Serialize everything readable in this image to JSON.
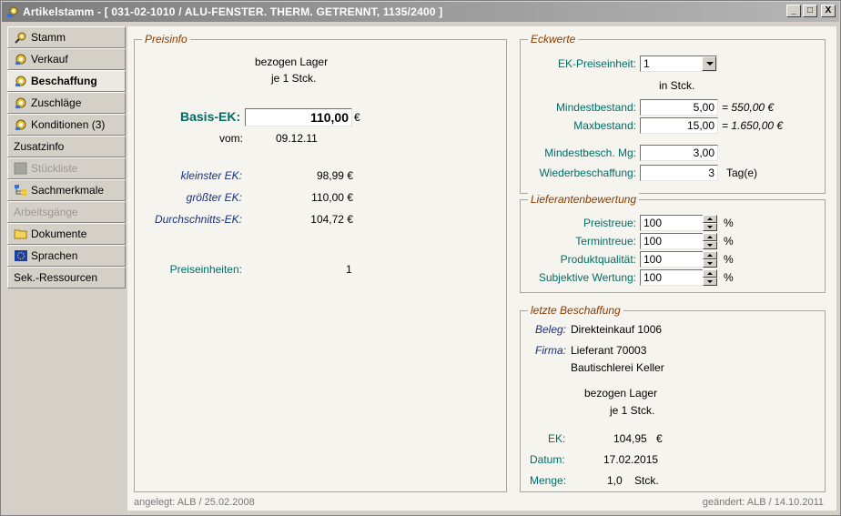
{
  "window": {
    "title": "Artikelstamm - [ 031-02-1010 / ALU-FENSTER. THERM. GETRENNT, 1135/2400 ]",
    "btn_minimize": "_",
    "btn_maximize": "□",
    "btn_close": "X"
  },
  "sidebar": {
    "items": [
      {
        "label": "Stamm"
      },
      {
        "label": "Verkauf"
      },
      {
        "label": "Beschaffung"
      },
      {
        "label": "Zuschläge"
      },
      {
        "label": "Konditionen (3)"
      },
      {
        "label": "Zusatzinfo"
      },
      {
        "label": "Stückliste"
      },
      {
        "label": "Sachmerkmale"
      },
      {
        "label": "Arbeitsgänge"
      },
      {
        "label": "Dokumente"
      },
      {
        "label": "Sprachen"
      },
      {
        "label": "Sek.-Ressourcen"
      }
    ]
  },
  "preisinfo": {
    "legend": "Preisinfo",
    "header_line1": "bezogen Lager",
    "header_line2": "je 1 Stck.",
    "basis_ek_label": "Basis-EK:",
    "basis_ek_value": "110,00",
    "currency": "€",
    "vom_label": "vom:",
    "vom_value": "09.12.11",
    "kleinster_label": "kleinster EK:",
    "kleinster_value": "98,99 €",
    "groesster_label": "größter EK:",
    "groesster_value": "110,00 €",
    "durchschnitt_label": "Durchschnitts-EK:",
    "durchschnitt_value": "104,72 €",
    "preiseinheiten_label": "Preiseinheiten:",
    "preiseinheiten_value": "1"
  },
  "eckwerte": {
    "legend": "Eckwerte",
    "ek_preiseinheit_label": "EK-Preiseinheit:",
    "ek_preiseinheit_value": "1",
    "unit_text": "in Stck.",
    "mindestbestand_label": "Mindestbestand:",
    "mindestbestand_value": "5,00",
    "mindestbestand_calc": "= 550,00 €",
    "maxbestand_label": "Maxbestand:",
    "maxbestand_value": "15,00",
    "maxbestand_calc": "= 1.650,00 €",
    "mindestbesch_label": "Mindestbesch. Mg:",
    "mindestbesch_value": "3,00",
    "wiederbeschaffung_label": "Wiederbeschaffung:",
    "wiederbeschaffung_value": "3",
    "wiederbeschaffung_unit": "Tag(e)"
  },
  "lieferanten": {
    "legend": "Lieferantenbewertung",
    "rows": [
      {
        "label": "Preistreue:",
        "value": "100",
        "unit": "%"
      },
      {
        "label": "Termintreue:",
        "value": "100",
        "unit": "%"
      },
      {
        "label": "Produktqualität:",
        "value": "100",
        "unit": "%"
      },
      {
        "label": "Subjektive Wertung:",
        "value": "100",
        "unit": "%"
      }
    ]
  },
  "letzte": {
    "legend": "letzte Beschaffung",
    "beleg_label": "Beleg:",
    "beleg_value": "Direkteinkauf 1006",
    "firma_label": "Firma:",
    "firma_line1": "Lieferant 70003",
    "firma_line2": "Bautischlerei Keller",
    "header_line1": "bezogen Lager",
    "header_line2": "je 1 Stck.",
    "ek_label": "EK:",
    "ek_value": "104,95",
    "ek_currency": "€",
    "datum_label": "Datum:",
    "datum_value": "17.02.2015",
    "menge_label": "Menge:",
    "menge_value": "1,0",
    "menge_unit": "Stck."
  },
  "footer": {
    "angelegt": "angelegt: ALB / 25.02.2008",
    "geaendert": "geändert: ALB / 14.10.2011"
  },
  "colors": {
    "label_teal": "#006e64",
    "label_navy": "#1b2f7e",
    "legend_brown": "#8a3b00"
  }
}
